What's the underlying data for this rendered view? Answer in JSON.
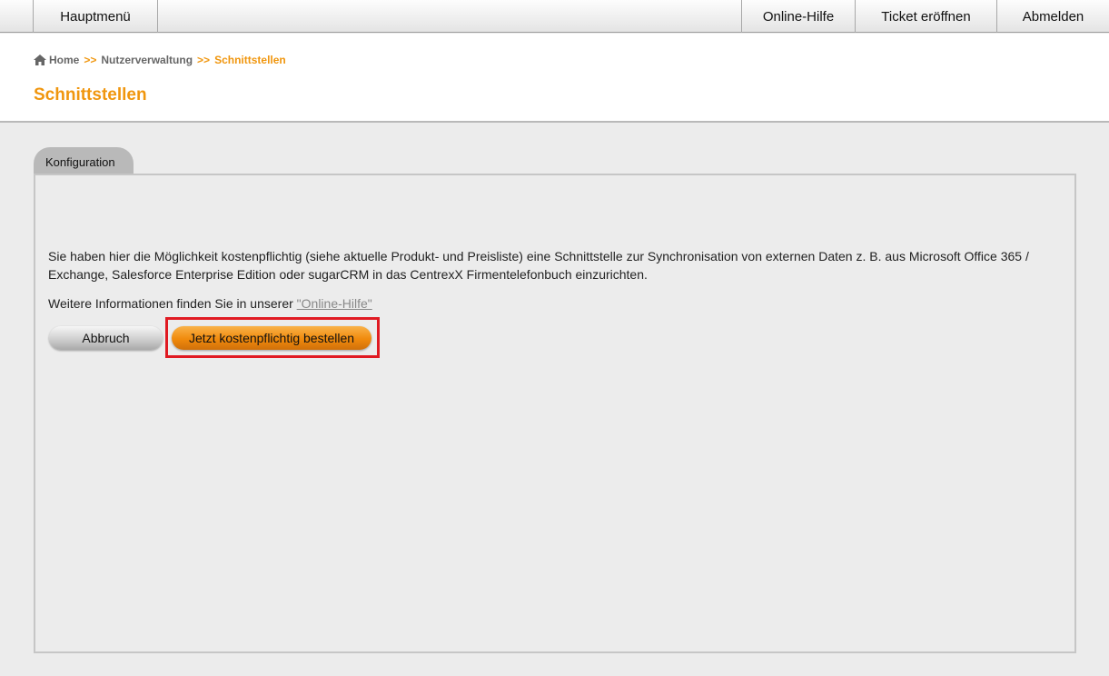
{
  "topnav": {
    "main_menu": "Hauptmenü",
    "help": "Online-Hilfe",
    "ticket": "Ticket eröffnen",
    "logout": "Abmelden"
  },
  "breadcrumb": {
    "home": "Home",
    "sep1": ">>",
    "users": "Nutzerverwaltung",
    "sep2": ">>",
    "current": "Schnittstellen"
  },
  "page": {
    "title": "Schnittstellen"
  },
  "tab": {
    "label": "Konfiguration"
  },
  "content": {
    "description": "Sie haben hier die Möglichkeit kostenpflichtig (siehe aktuelle Produkt- und Preisliste) eine Schnittstelle zur Synchronisation von externen Daten z. B. aus Microsoft Office 365 / Exchange, Salesforce Enterprise Edition oder sugarCRM in das CentrexX Firmentelefonbuch einzurichten.",
    "more_info": "Weitere Informationen finden Sie in unserer",
    "help_link": "\"Online-Hilfe\""
  },
  "buttons": {
    "cancel": "Abbruch",
    "order": "Jetzt kostenpflichtig bestellen"
  },
  "colors": {
    "accent": "#f0960e",
    "highlight": "#e01a22"
  }
}
